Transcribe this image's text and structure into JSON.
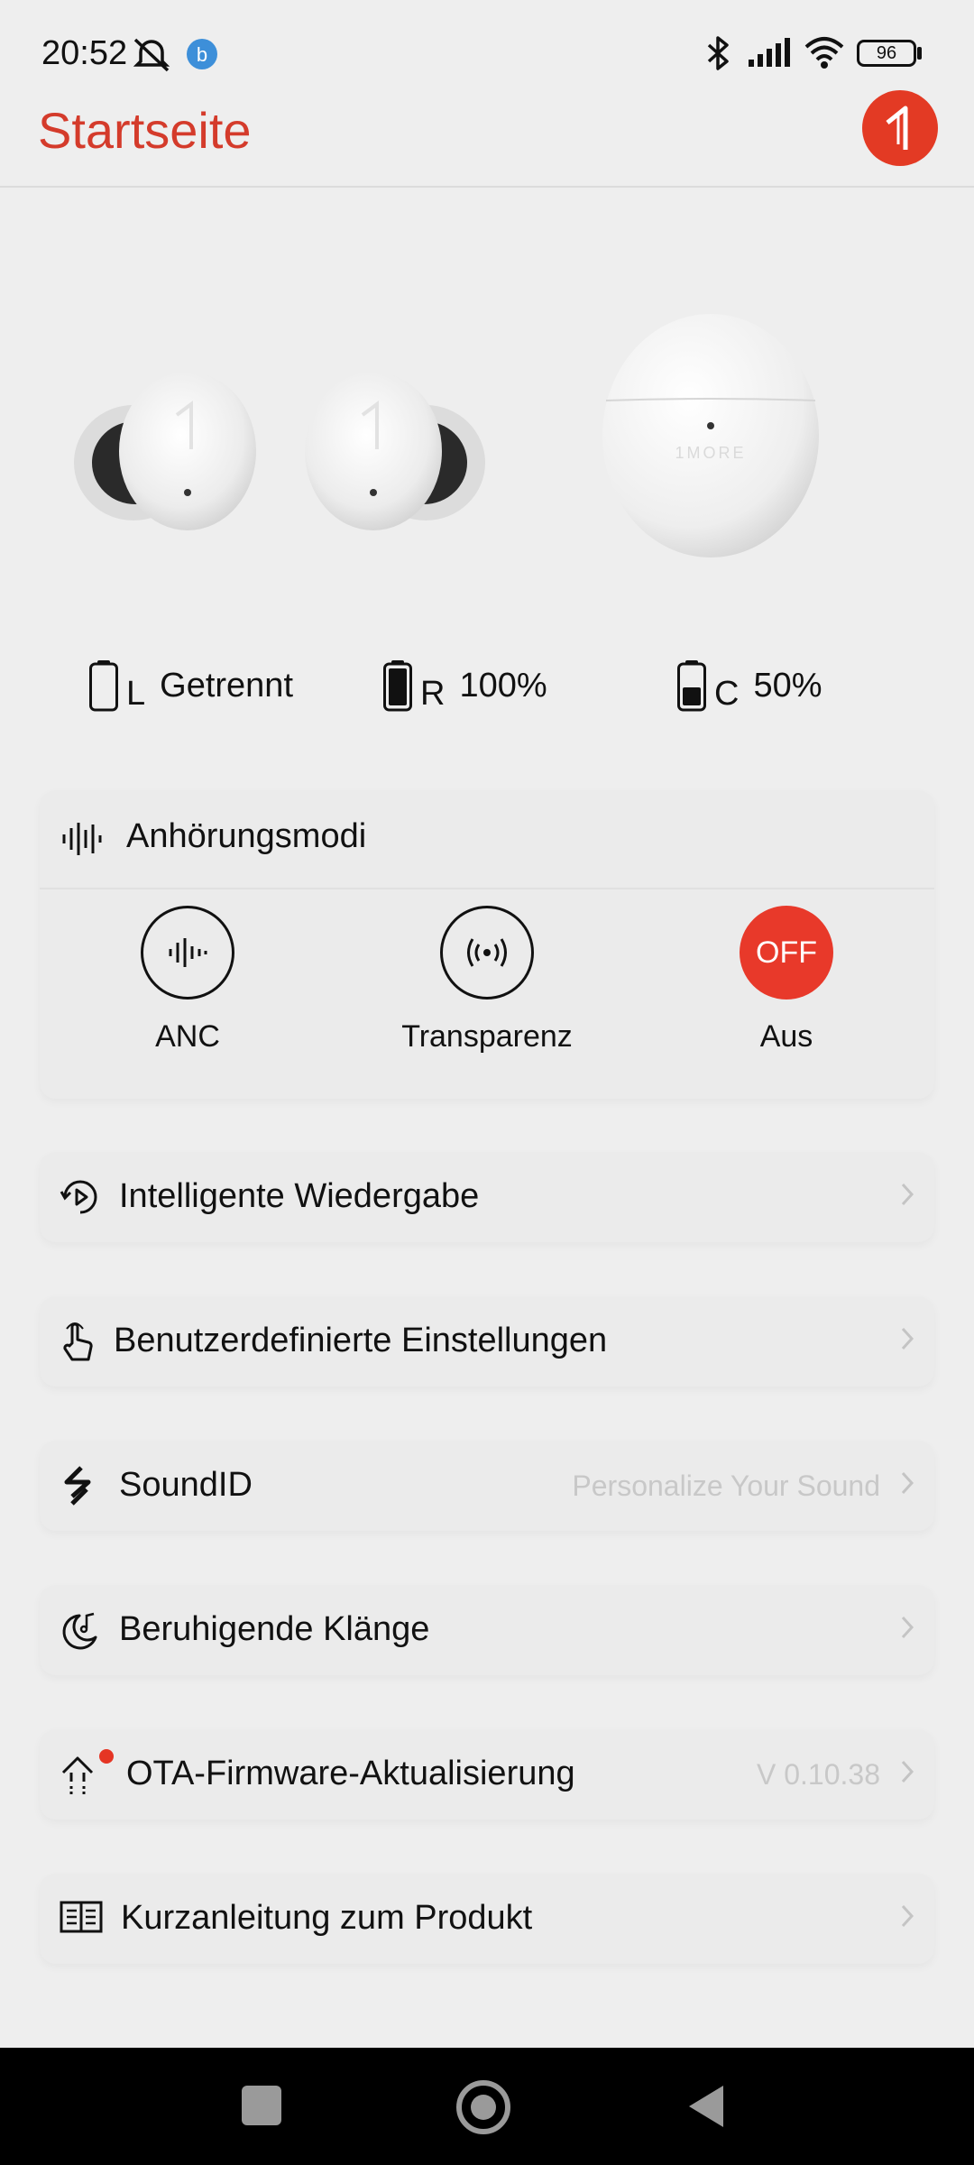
{
  "status_bar": {
    "time": "20:52",
    "battery_level": "96",
    "icons": [
      "mute-icon",
      "app-b-icon",
      "bluetooth-icon",
      "signal-icon",
      "wifi-icon",
      "battery-icon"
    ]
  },
  "header": {
    "title": "Startseite",
    "logo": "1more-logo-icon"
  },
  "battery": {
    "left": {
      "side": "L",
      "status": "Getrennt"
    },
    "right": {
      "side": "R",
      "status": "100%"
    },
    "case": {
      "side": "C",
      "status": "50%"
    }
  },
  "listening_modes": {
    "title": "Anhörungsmodi",
    "modes": [
      {
        "label": "ANC",
        "icon": "anc-waveform-icon",
        "active": false
      },
      {
        "label": "Transparenz",
        "icon": "transparency-icon",
        "active": false
      },
      {
        "label": "Aus",
        "icon_text": "OFF",
        "active": true
      }
    ]
  },
  "menu": [
    {
      "label": "Intelligente Wiedergabe",
      "icon": "smart-play-icon",
      "value": ""
    },
    {
      "label": "Benutzerdefinierte Einstellungen",
      "icon": "touch-gesture-icon",
      "value": ""
    },
    {
      "label": "SoundID",
      "icon": "soundid-icon",
      "value": "Personalize Your Sound"
    },
    {
      "label": "Beruhigende Klänge",
      "icon": "moon-music-icon",
      "value": ""
    },
    {
      "label": "OTA-Firmware-Aktualisierung",
      "icon": "firmware-update-icon",
      "value": "V 0.10.38",
      "badge": true
    },
    {
      "label": "Kurzanleitung zum Produkt",
      "icon": "book-icon",
      "value": ""
    }
  ],
  "colors": {
    "accent": "#d43b2b",
    "off_button": "#e8392a",
    "background": "#eeeeee",
    "card": "#ebebeb",
    "muted_text": "#c8c8c8"
  }
}
